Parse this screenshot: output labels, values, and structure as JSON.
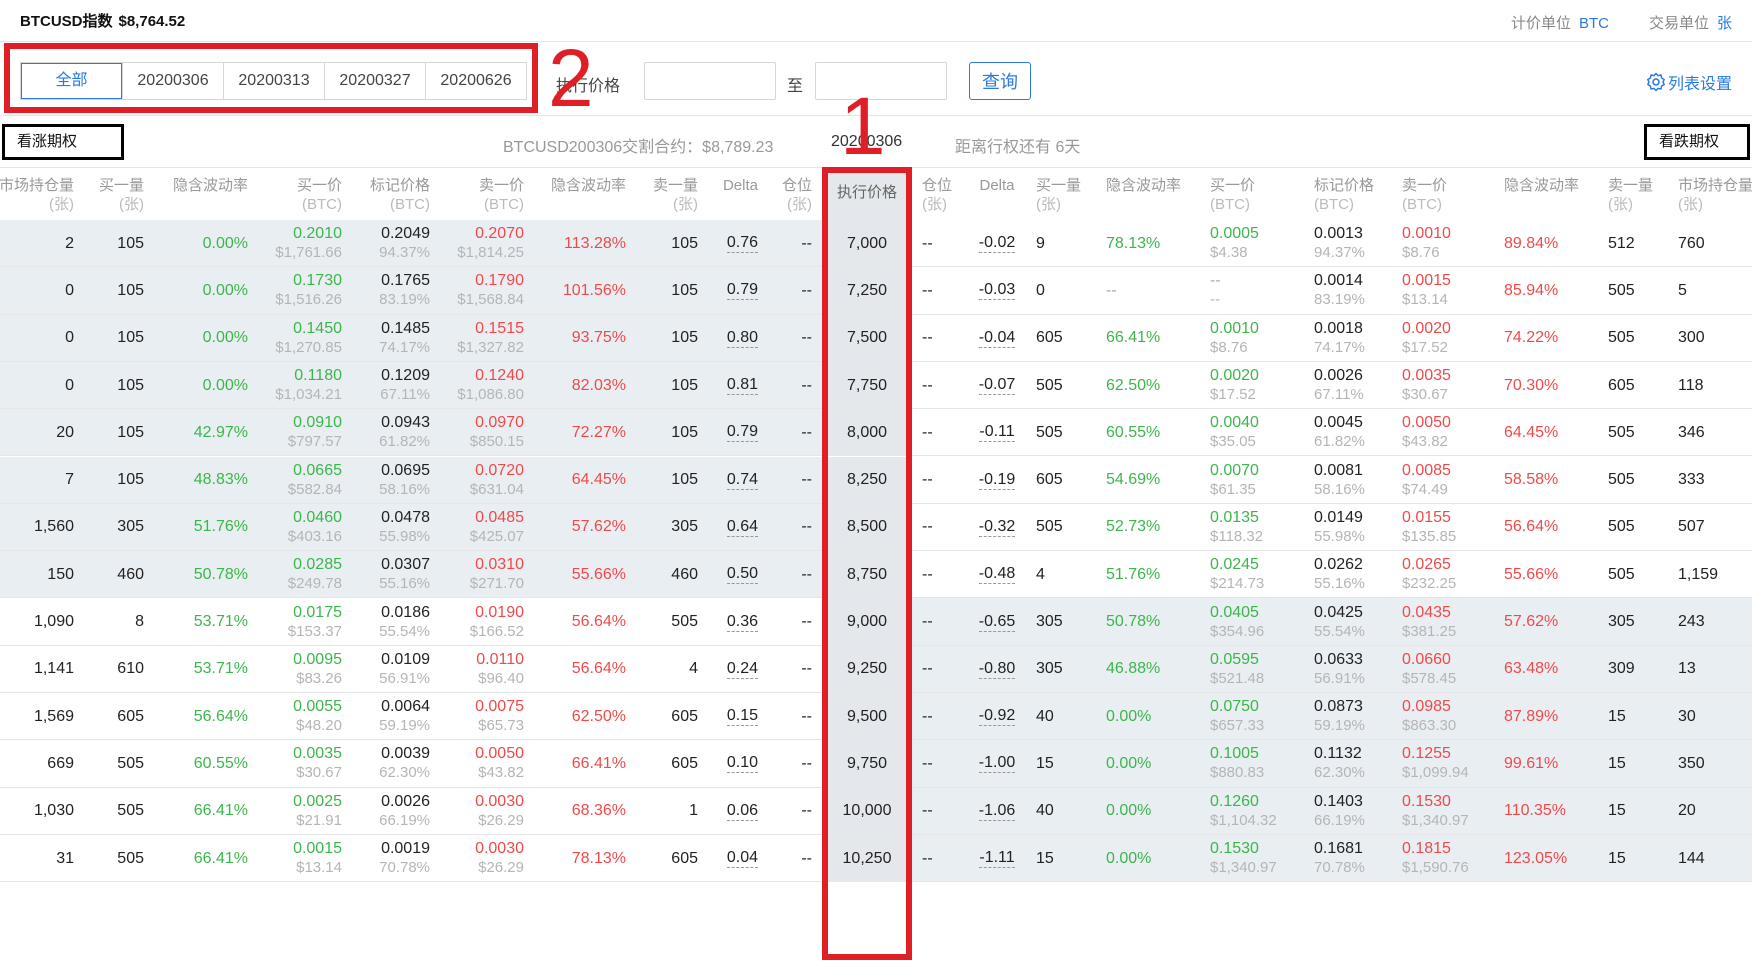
{
  "header": {
    "index_label": "BTCUSD指数",
    "index_price": "$8,764.52",
    "price_unit_label": "计价单位",
    "price_unit_value": "BTC",
    "trade_unit_label": "交易单位",
    "trade_unit_value": "张"
  },
  "filters": {
    "tabs": [
      "全部",
      "20200306",
      "20200313",
      "20200327",
      "20200626"
    ],
    "active_tab": "全部",
    "strike_label": "执行价格",
    "strike_from_placeholder": "",
    "to_label": "至",
    "strike_to_placeholder": "",
    "query_label": "查询",
    "settings_label": "列表设置"
  },
  "info": {
    "calls_label": "看涨期权",
    "puts_label": "看跌期权",
    "contract": "BTCUSD200306交割合约：$8,789.23",
    "expiry": "20200306",
    "remaining": "距离行权还有 6天"
  },
  "annotations": [
    "1",
    "2"
  ],
  "colors": {
    "accent": "#2a7ae2",
    "green": "#3cb64b",
    "red": "#ef4a4a",
    "annotation": "#e01e25",
    "itm_bg": "#e9eef3",
    "strike_bg": "#e4e7eb"
  },
  "columns": {
    "call": [
      "市场持仓量(张)",
      "买一量(张)",
      "隐含波动率",
      "买一价(BTC)",
      "标记价格(BTC)",
      "卖一价(BTC)",
      "隐含波动率",
      "卖一量(张)",
      "Delta",
      "仓位(张)"
    ],
    "strike": "执行价格",
    "put": [
      "仓位(张)",
      "Delta",
      "买一量(张)",
      "隐含波动率",
      "买一价(BTC)",
      "标记价格(BTC)",
      "卖一价(BTC)",
      "隐含波动率",
      "卖一量(张)",
      "市场持仓量(张)"
    ]
  },
  "headers": {
    "oi": "市场持仓量",
    "bidqty": "买一量",
    "iv": "隐含波动率",
    "bid": "买一价",
    "mark": "标记价格",
    "ask": "卖一价",
    "askqty": "卖一量",
    "delta": "Delta",
    "pos": "仓位",
    "strike": "执行价格",
    "unit_zhang": "(张)",
    "unit_btc": "(BTC)"
  },
  "rows": [
    {
      "call_itm": true,
      "put_itm": false,
      "call": {
        "oi": "2",
        "bidqty": "105",
        "biv": "0.00%",
        "bid": "0.2010",
        "bid_usd": "$1,761.66",
        "mark": "0.2049",
        "mark_pct": "94.37%",
        "ask": "0.2070",
        "ask_usd": "$1,814.25",
        "aiv": "113.28%",
        "askqty": "105",
        "delta": "0.76",
        "pos": "--"
      },
      "strike": "7,000",
      "put": {
        "pos": "--",
        "delta": "-0.02",
        "bidqty": "9",
        "biv": "78.13%",
        "bid": "0.0005",
        "bid_usd": "$4.38",
        "mark": "0.0013",
        "mark_pct": "94.37%",
        "ask": "0.0010",
        "ask_usd": "$8.76",
        "aiv": "89.84%",
        "askqty": "512",
        "oi": "760"
      }
    },
    {
      "call_itm": true,
      "put_itm": false,
      "call": {
        "oi": "0",
        "bidqty": "105",
        "biv": "0.00%",
        "bid": "0.1730",
        "bid_usd": "$1,516.26",
        "mark": "0.1765",
        "mark_pct": "83.19%",
        "ask": "0.1790",
        "ask_usd": "$1,568.84",
        "aiv": "101.56%",
        "askqty": "105",
        "delta": "0.79",
        "pos": "--"
      },
      "strike": "7,250",
      "put": {
        "pos": "--",
        "delta": "-0.03",
        "bidqty": "0",
        "biv": "--",
        "bid": "--",
        "bid_usd": "--",
        "mark": "0.0014",
        "mark_pct": "83.19%",
        "ask": "0.0015",
        "ask_usd": "$13.14",
        "aiv": "85.94%",
        "askqty": "505",
        "oi": "5"
      }
    },
    {
      "call_itm": true,
      "put_itm": false,
      "call": {
        "oi": "0",
        "bidqty": "105",
        "biv": "0.00%",
        "bid": "0.1450",
        "bid_usd": "$1,270.85",
        "mark": "0.1485",
        "mark_pct": "74.17%",
        "ask": "0.1515",
        "ask_usd": "$1,327.82",
        "aiv": "93.75%",
        "askqty": "105",
        "delta": "0.80",
        "pos": "--"
      },
      "strike": "7,500",
      "put": {
        "pos": "--",
        "delta": "-0.04",
        "bidqty": "605",
        "biv": "66.41%",
        "bid": "0.0010",
        "bid_usd": "$8.76",
        "mark": "0.0018",
        "mark_pct": "74.17%",
        "ask": "0.0020",
        "ask_usd": "$17.52",
        "aiv": "74.22%",
        "askqty": "505",
        "oi": "300"
      }
    },
    {
      "call_itm": true,
      "put_itm": false,
      "call": {
        "oi": "0",
        "bidqty": "105",
        "biv": "0.00%",
        "bid": "0.1180",
        "bid_usd": "$1,034.21",
        "mark": "0.1209",
        "mark_pct": "67.11%",
        "ask": "0.1240",
        "ask_usd": "$1,086.80",
        "aiv": "82.03%",
        "askqty": "105",
        "delta": "0.81",
        "pos": "--"
      },
      "strike": "7,750",
      "put": {
        "pos": "--",
        "delta": "-0.07",
        "bidqty": "505",
        "biv": "62.50%",
        "bid": "0.0020",
        "bid_usd": "$17.52",
        "mark": "0.0026",
        "mark_pct": "67.11%",
        "ask": "0.0035",
        "ask_usd": "$30.67",
        "aiv": "70.30%",
        "askqty": "605",
        "oi": "118"
      }
    },
    {
      "call_itm": true,
      "put_itm": false,
      "call": {
        "oi": "20",
        "bidqty": "105",
        "biv": "42.97%",
        "bid": "0.0910",
        "bid_usd": "$797.57",
        "mark": "0.0943",
        "mark_pct": "61.82%",
        "ask": "0.0970",
        "ask_usd": "$850.15",
        "aiv": "72.27%",
        "askqty": "105",
        "delta": "0.79",
        "pos": "--"
      },
      "strike": "8,000",
      "put": {
        "pos": "--",
        "delta": "-0.11",
        "bidqty": "505",
        "biv": "60.55%",
        "bid": "0.0040",
        "bid_usd": "$35.05",
        "mark": "0.0045",
        "mark_pct": "61.82%",
        "ask": "0.0050",
        "ask_usd": "$43.82",
        "aiv": "64.45%",
        "askqty": "505",
        "oi": "346"
      }
    },
    {
      "call_itm": true,
      "put_itm": false,
      "call": {
        "oi": "7",
        "bidqty": "105",
        "biv": "48.83%",
        "bid": "0.0665",
        "bid_usd": "$582.84",
        "mark": "0.0695",
        "mark_pct": "58.16%",
        "ask": "0.0720",
        "ask_usd": "$631.04",
        "aiv": "64.45%",
        "askqty": "105",
        "delta": "0.74",
        "pos": "--"
      },
      "strike": "8,250",
      "put": {
        "pos": "--",
        "delta": "-0.19",
        "bidqty": "605",
        "biv": "54.69%",
        "bid": "0.0070",
        "bid_usd": "$61.35",
        "mark": "0.0081",
        "mark_pct": "58.16%",
        "ask": "0.0085",
        "ask_usd": "$74.49",
        "aiv": "58.58%",
        "askqty": "505",
        "oi": "333"
      }
    },
    {
      "call_itm": true,
      "put_itm": false,
      "call": {
        "oi": "1,560",
        "bidqty": "305",
        "biv": "51.76%",
        "bid": "0.0460",
        "bid_usd": "$403.16",
        "mark": "0.0478",
        "mark_pct": "55.98%",
        "ask": "0.0485",
        "ask_usd": "$425.07",
        "aiv": "57.62%",
        "askqty": "305",
        "delta": "0.64",
        "pos": "--"
      },
      "strike": "8,500",
      "put": {
        "pos": "--",
        "delta": "-0.32",
        "bidqty": "505",
        "biv": "52.73%",
        "bid": "0.0135",
        "bid_usd": "$118.32",
        "mark": "0.0149",
        "mark_pct": "55.98%",
        "ask": "0.0155",
        "ask_usd": "$135.85",
        "aiv": "56.64%",
        "askqty": "505",
        "oi": "507"
      }
    },
    {
      "call_itm": true,
      "put_itm": false,
      "call": {
        "oi": "150",
        "bidqty": "460",
        "biv": "50.78%",
        "bid": "0.0285",
        "bid_usd": "$249.78",
        "mark": "0.0307",
        "mark_pct": "55.16%",
        "ask": "0.0310",
        "ask_usd": "$271.70",
        "aiv": "55.66%",
        "askqty": "460",
        "delta": "0.50",
        "pos": "--"
      },
      "strike": "8,750",
      "put": {
        "pos": "--",
        "delta": "-0.48",
        "bidqty": "4",
        "biv": "51.76%",
        "bid": "0.0245",
        "bid_usd": "$214.73",
        "mark": "0.0262",
        "mark_pct": "55.16%",
        "ask": "0.0265",
        "ask_usd": "$232.25",
        "aiv": "55.66%",
        "askqty": "505",
        "oi": "1,159"
      }
    },
    {
      "call_itm": false,
      "put_itm": true,
      "call": {
        "oi": "1,090",
        "bidqty": "8",
        "biv": "53.71%",
        "bid": "0.0175",
        "bid_usd": "$153.37",
        "mark": "0.0186",
        "mark_pct": "55.54%",
        "ask": "0.0190",
        "ask_usd": "$166.52",
        "aiv": "56.64%",
        "askqty": "505",
        "delta": "0.36",
        "pos": "--"
      },
      "strike": "9,000",
      "put": {
        "pos": "--",
        "delta": "-0.65",
        "bidqty": "305",
        "biv": "50.78%",
        "bid": "0.0405",
        "bid_usd": "$354.96",
        "mark": "0.0425",
        "mark_pct": "55.54%",
        "ask": "0.0435",
        "ask_usd": "$381.25",
        "aiv": "57.62%",
        "askqty": "305",
        "oi": "243"
      }
    },
    {
      "call_itm": false,
      "put_itm": true,
      "call": {
        "oi": "1,141",
        "bidqty": "610",
        "biv": "53.71%",
        "bid": "0.0095",
        "bid_usd": "$83.26",
        "mark": "0.0109",
        "mark_pct": "56.91%",
        "ask": "0.0110",
        "ask_usd": "$96.40",
        "aiv": "56.64%",
        "askqty": "4",
        "delta": "0.24",
        "pos": "--"
      },
      "strike": "9,250",
      "put": {
        "pos": "--",
        "delta": "-0.80",
        "bidqty": "305",
        "biv": "46.88%",
        "bid": "0.0595",
        "bid_usd": "$521.48",
        "mark": "0.0633",
        "mark_pct": "56.91%",
        "ask": "0.0660",
        "ask_usd": "$578.45",
        "aiv": "63.48%",
        "askqty": "309",
        "oi": "13"
      }
    },
    {
      "call_itm": false,
      "put_itm": true,
      "call": {
        "oi": "1,569",
        "bidqty": "605",
        "biv": "56.64%",
        "bid": "0.0055",
        "bid_usd": "$48.20",
        "mark": "0.0064",
        "mark_pct": "59.19%",
        "ask": "0.0075",
        "ask_usd": "$65.73",
        "aiv": "62.50%",
        "askqty": "605",
        "delta": "0.15",
        "pos": "--"
      },
      "strike": "9,500",
      "put": {
        "pos": "--",
        "delta": "-0.92",
        "bidqty": "40",
        "biv": "0.00%",
        "bid": "0.0750",
        "bid_usd": "$657.33",
        "mark": "0.0873",
        "mark_pct": "59.19%",
        "ask": "0.0985",
        "ask_usd": "$863.30",
        "aiv": "87.89%",
        "askqty": "15",
        "oi": "30"
      }
    },
    {
      "call_itm": false,
      "put_itm": true,
      "call": {
        "oi": "669",
        "bidqty": "505",
        "biv": "60.55%",
        "bid": "0.0035",
        "bid_usd": "$30.67",
        "mark": "0.0039",
        "mark_pct": "62.30%",
        "ask": "0.0050",
        "ask_usd": "$43.82",
        "aiv": "66.41%",
        "askqty": "605",
        "delta": "0.10",
        "pos": "--"
      },
      "strike": "9,750",
      "put": {
        "pos": "--",
        "delta": "-1.00",
        "bidqty": "15",
        "biv": "0.00%",
        "bid": "0.1005",
        "bid_usd": "$880.83",
        "mark": "0.1132",
        "mark_pct": "62.30%",
        "ask": "0.1255",
        "ask_usd": "$1,099.94",
        "aiv": "99.61%",
        "askqty": "15",
        "oi": "350"
      }
    },
    {
      "call_itm": false,
      "put_itm": true,
      "call": {
        "oi": "1,030",
        "bidqty": "505",
        "biv": "66.41%",
        "bid": "0.0025",
        "bid_usd": "$21.91",
        "mark": "0.0026",
        "mark_pct": "66.19%",
        "ask": "0.0030",
        "ask_usd": "$26.29",
        "aiv": "68.36%",
        "askqty": "1",
        "delta": "0.06",
        "pos": "--"
      },
      "strike": "10,000",
      "put": {
        "pos": "--",
        "delta": "-1.06",
        "bidqty": "40",
        "biv": "0.00%",
        "bid": "0.1260",
        "bid_usd": "$1,104.32",
        "mark": "0.1403",
        "mark_pct": "66.19%",
        "ask": "0.1530",
        "ask_usd": "$1,340.97",
        "aiv": "110.35%",
        "askqty": "15",
        "oi": "20"
      }
    },
    {
      "call_itm": false,
      "put_itm": true,
      "call": {
        "oi": "31",
        "bidqty": "505",
        "biv": "66.41%",
        "bid": "0.0015",
        "bid_usd": "$13.14",
        "mark": "0.0019",
        "mark_pct": "70.78%",
        "ask": "0.0030",
        "ask_usd": "$26.29",
        "aiv": "78.13%",
        "askqty": "605",
        "delta": "0.04",
        "pos": "--"
      },
      "strike": "10,250",
      "put": {
        "pos": "--",
        "delta": "-1.11",
        "bidqty": "15",
        "biv": "0.00%",
        "bid": "0.1530",
        "bid_usd": "$1,340.97",
        "mark": "0.1681",
        "mark_pct": "70.78%",
        "ask": "0.1815",
        "ask_usd": "$1,590.76",
        "aiv": "123.05%",
        "askqty": "15",
        "oi": "144"
      }
    }
  ]
}
